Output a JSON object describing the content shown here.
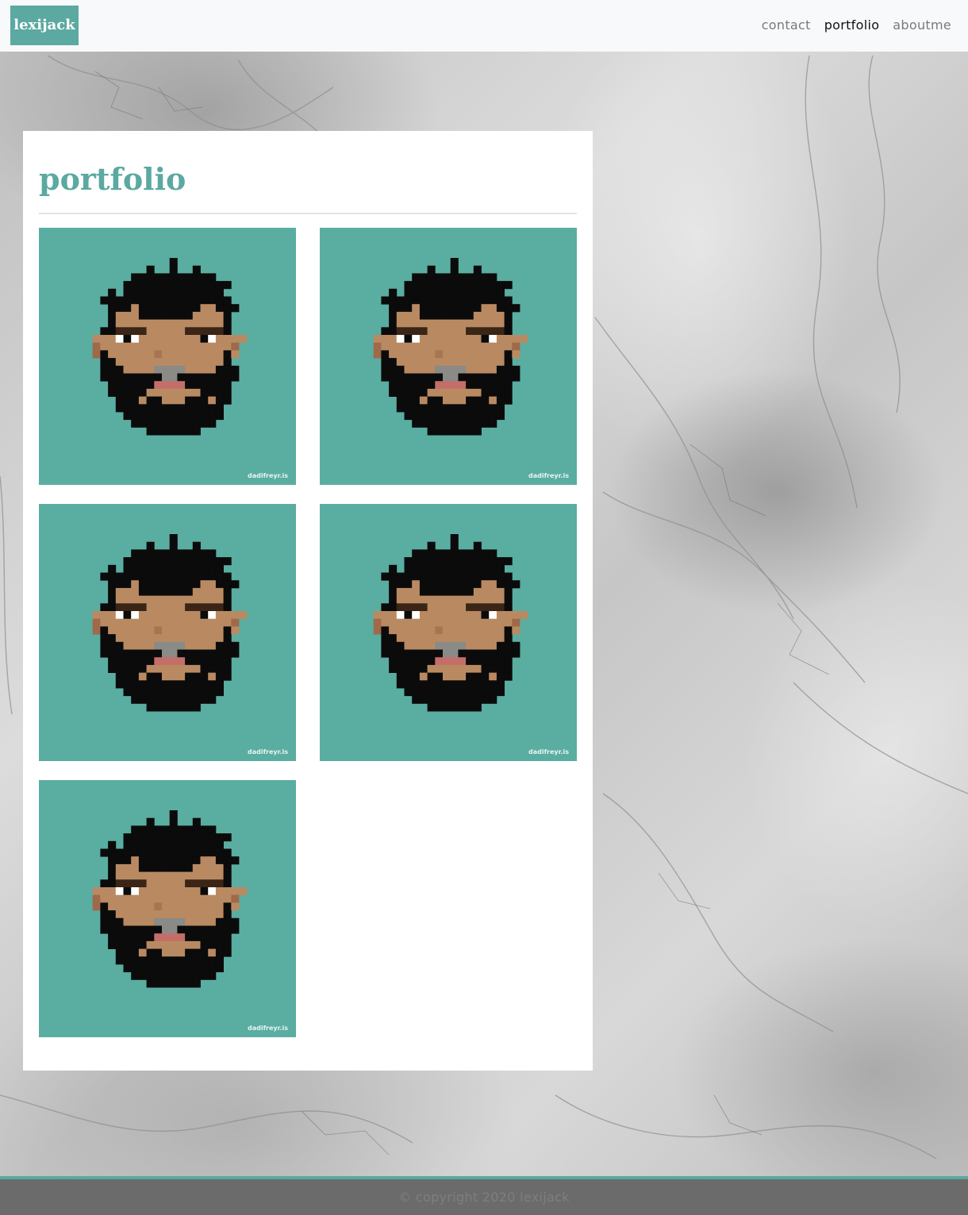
{
  "navbar": {
    "brand": "lexijack",
    "links": [
      {
        "label": "contact",
        "active": false
      },
      {
        "label": "portfolio",
        "active": true
      },
      {
        "label": "aboutme",
        "active": false
      }
    ]
  },
  "main": {
    "title": "portfolio",
    "gallery": [
      {
        "alt": "pixel art portrait",
        "watermark": "dadifreyr.is"
      },
      {
        "alt": "pixel art portrait",
        "watermark": "dadifreyr.is"
      },
      {
        "alt": "pixel art portrait",
        "watermark": "dadifreyr.is"
      },
      {
        "alt": "pixel art portrait",
        "watermark": "dadifreyr.is"
      },
      {
        "alt": "pixel art portrait",
        "watermark": "dadifreyr.is"
      }
    ]
  },
  "footer": {
    "text": "© copyright 2020 lexijack"
  },
  "colors": {
    "accent": "#5ba9a0",
    "tile_background": "#5aada1",
    "navbar_background": "#f8f9fa",
    "footer_background": "#6b6b6b"
  }
}
